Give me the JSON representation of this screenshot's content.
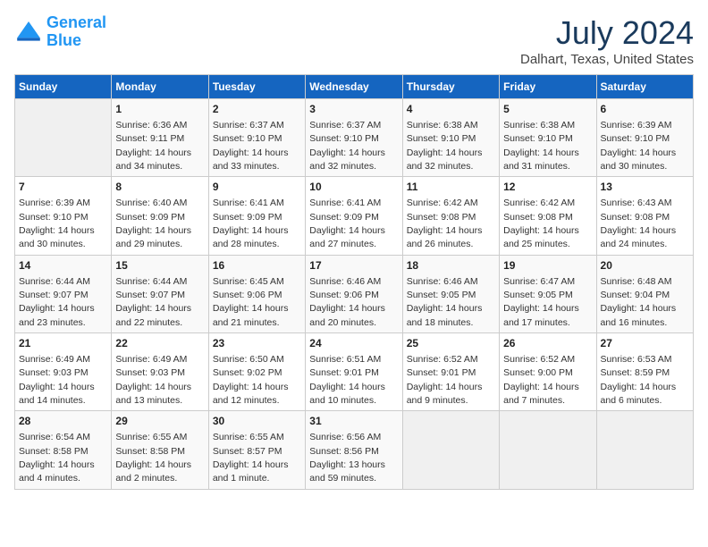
{
  "header": {
    "logo_line1": "General",
    "logo_line2": "Blue",
    "month": "July 2024",
    "location": "Dalhart, Texas, United States"
  },
  "weekdays": [
    "Sunday",
    "Monday",
    "Tuesday",
    "Wednesday",
    "Thursday",
    "Friday",
    "Saturday"
  ],
  "weeks": [
    [
      {
        "day": "",
        "sunrise": "",
        "sunset": "",
        "daylight": ""
      },
      {
        "day": "1",
        "sunrise": "Sunrise: 6:36 AM",
        "sunset": "Sunset: 9:11 PM",
        "daylight": "Daylight: 14 hours and 34 minutes."
      },
      {
        "day": "2",
        "sunrise": "Sunrise: 6:37 AM",
        "sunset": "Sunset: 9:10 PM",
        "daylight": "Daylight: 14 hours and 33 minutes."
      },
      {
        "day": "3",
        "sunrise": "Sunrise: 6:37 AM",
        "sunset": "Sunset: 9:10 PM",
        "daylight": "Daylight: 14 hours and 32 minutes."
      },
      {
        "day": "4",
        "sunrise": "Sunrise: 6:38 AM",
        "sunset": "Sunset: 9:10 PM",
        "daylight": "Daylight: 14 hours and 32 minutes."
      },
      {
        "day": "5",
        "sunrise": "Sunrise: 6:38 AM",
        "sunset": "Sunset: 9:10 PM",
        "daylight": "Daylight: 14 hours and 31 minutes."
      },
      {
        "day": "6",
        "sunrise": "Sunrise: 6:39 AM",
        "sunset": "Sunset: 9:10 PM",
        "daylight": "Daylight: 14 hours and 30 minutes."
      }
    ],
    [
      {
        "day": "7",
        "sunrise": "Sunrise: 6:39 AM",
        "sunset": "Sunset: 9:10 PM",
        "daylight": "Daylight: 14 hours and 30 minutes."
      },
      {
        "day": "8",
        "sunrise": "Sunrise: 6:40 AM",
        "sunset": "Sunset: 9:09 PM",
        "daylight": "Daylight: 14 hours and 29 minutes."
      },
      {
        "day": "9",
        "sunrise": "Sunrise: 6:41 AM",
        "sunset": "Sunset: 9:09 PM",
        "daylight": "Daylight: 14 hours and 28 minutes."
      },
      {
        "day": "10",
        "sunrise": "Sunrise: 6:41 AM",
        "sunset": "Sunset: 9:09 PM",
        "daylight": "Daylight: 14 hours and 27 minutes."
      },
      {
        "day": "11",
        "sunrise": "Sunrise: 6:42 AM",
        "sunset": "Sunset: 9:08 PM",
        "daylight": "Daylight: 14 hours and 26 minutes."
      },
      {
        "day": "12",
        "sunrise": "Sunrise: 6:42 AM",
        "sunset": "Sunset: 9:08 PM",
        "daylight": "Daylight: 14 hours and 25 minutes."
      },
      {
        "day": "13",
        "sunrise": "Sunrise: 6:43 AM",
        "sunset": "Sunset: 9:08 PM",
        "daylight": "Daylight: 14 hours and 24 minutes."
      }
    ],
    [
      {
        "day": "14",
        "sunrise": "Sunrise: 6:44 AM",
        "sunset": "Sunset: 9:07 PM",
        "daylight": "Daylight: 14 hours and 23 minutes."
      },
      {
        "day": "15",
        "sunrise": "Sunrise: 6:44 AM",
        "sunset": "Sunset: 9:07 PM",
        "daylight": "Daylight: 14 hours and 22 minutes."
      },
      {
        "day": "16",
        "sunrise": "Sunrise: 6:45 AM",
        "sunset": "Sunset: 9:06 PM",
        "daylight": "Daylight: 14 hours and 21 minutes."
      },
      {
        "day": "17",
        "sunrise": "Sunrise: 6:46 AM",
        "sunset": "Sunset: 9:06 PM",
        "daylight": "Daylight: 14 hours and 20 minutes."
      },
      {
        "day": "18",
        "sunrise": "Sunrise: 6:46 AM",
        "sunset": "Sunset: 9:05 PM",
        "daylight": "Daylight: 14 hours and 18 minutes."
      },
      {
        "day": "19",
        "sunrise": "Sunrise: 6:47 AM",
        "sunset": "Sunset: 9:05 PM",
        "daylight": "Daylight: 14 hours and 17 minutes."
      },
      {
        "day": "20",
        "sunrise": "Sunrise: 6:48 AM",
        "sunset": "Sunset: 9:04 PM",
        "daylight": "Daylight: 14 hours and 16 minutes."
      }
    ],
    [
      {
        "day": "21",
        "sunrise": "Sunrise: 6:49 AM",
        "sunset": "Sunset: 9:03 PM",
        "daylight": "Daylight: 14 hours and 14 minutes."
      },
      {
        "day": "22",
        "sunrise": "Sunrise: 6:49 AM",
        "sunset": "Sunset: 9:03 PM",
        "daylight": "Daylight: 14 hours and 13 minutes."
      },
      {
        "day": "23",
        "sunrise": "Sunrise: 6:50 AM",
        "sunset": "Sunset: 9:02 PM",
        "daylight": "Daylight: 14 hours and 12 minutes."
      },
      {
        "day": "24",
        "sunrise": "Sunrise: 6:51 AM",
        "sunset": "Sunset: 9:01 PM",
        "daylight": "Daylight: 14 hours and 10 minutes."
      },
      {
        "day": "25",
        "sunrise": "Sunrise: 6:52 AM",
        "sunset": "Sunset: 9:01 PM",
        "daylight": "Daylight: 14 hours and 9 minutes."
      },
      {
        "day": "26",
        "sunrise": "Sunrise: 6:52 AM",
        "sunset": "Sunset: 9:00 PM",
        "daylight": "Daylight: 14 hours and 7 minutes."
      },
      {
        "day": "27",
        "sunrise": "Sunrise: 6:53 AM",
        "sunset": "Sunset: 8:59 PM",
        "daylight": "Daylight: 14 hours and 6 minutes."
      }
    ],
    [
      {
        "day": "28",
        "sunrise": "Sunrise: 6:54 AM",
        "sunset": "Sunset: 8:58 PM",
        "daylight": "Daylight: 14 hours and 4 minutes."
      },
      {
        "day": "29",
        "sunrise": "Sunrise: 6:55 AM",
        "sunset": "Sunset: 8:58 PM",
        "daylight": "Daylight: 14 hours and 2 minutes."
      },
      {
        "day": "30",
        "sunrise": "Sunrise: 6:55 AM",
        "sunset": "Sunset: 8:57 PM",
        "daylight": "Daylight: 14 hours and 1 minute."
      },
      {
        "day": "31",
        "sunrise": "Sunrise: 6:56 AM",
        "sunset": "Sunset: 8:56 PM",
        "daylight": "Daylight: 13 hours and 59 minutes."
      },
      {
        "day": "",
        "sunrise": "",
        "sunset": "",
        "daylight": ""
      },
      {
        "day": "",
        "sunrise": "",
        "sunset": "",
        "daylight": ""
      },
      {
        "day": "",
        "sunrise": "",
        "sunset": "",
        "daylight": ""
      }
    ]
  ]
}
